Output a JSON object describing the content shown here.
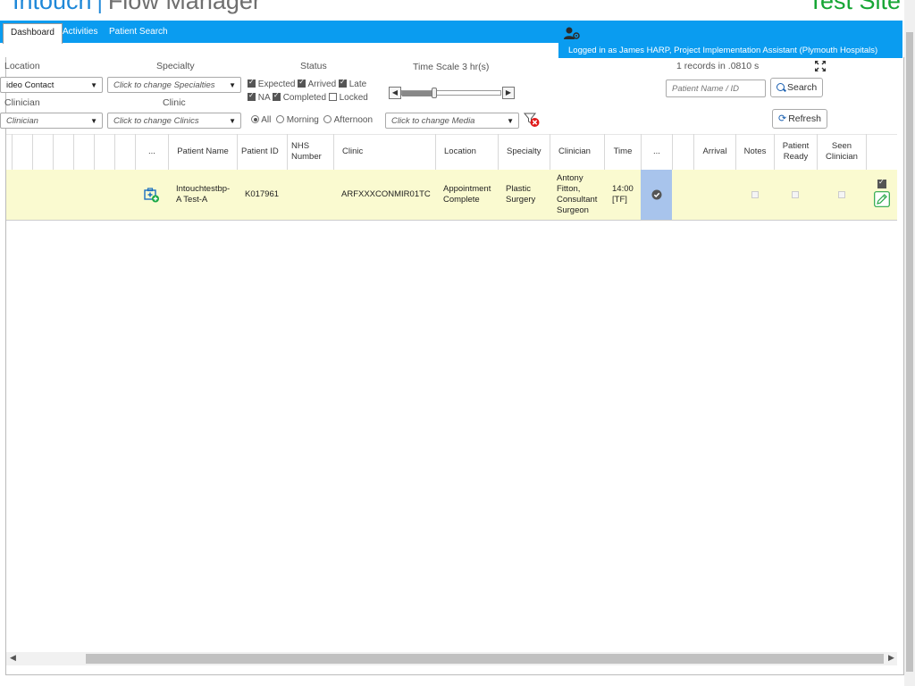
{
  "header": {
    "brand": "Intouch",
    "separator": "|",
    "product": "Flow Manager",
    "site": "Test Site"
  },
  "nav": {
    "tabs": [
      {
        "label": "Dashboard",
        "active": true
      },
      {
        "label": "Activities",
        "active": false
      },
      {
        "label": "Patient Search",
        "active": false
      }
    ],
    "user_icon": "user-gear-icon",
    "login_text": "Logged in as James HARP, Project Implementation Assistant (Plymouth Hospitals)"
  },
  "filters": {
    "location_label": "Location",
    "location_value": "ideo Contact",
    "specialty_label": "Specialty",
    "specialty_placeholder": "Click to change Specialties",
    "clinician_label": "Clinician",
    "clinician_value": "Clinician",
    "clinic_label": "Clinic",
    "clinic_placeholder": "Click to change Clinics",
    "status_label": "Status",
    "statuses": [
      {
        "label": "Expected",
        "checked": true
      },
      {
        "label": "Arrived",
        "checked": true
      },
      {
        "label": "Late",
        "checked": true
      },
      {
        "label": "NA",
        "checked": true
      },
      {
        "label": "Completed",
        "checked": true
      },
      {
        "label": "Locked",
        "checked": false
      }
    ],
    "time_options": [
      {
        "label": "All",
        "selected": true
      },
      {
        "label": "Morning",
        "selected": false
      },
      {
        "label": "Afternoon",
        "selected": false
      }
    ],
    "media_placeholder": "Click to change Media",
    "timescale_label": "Time Scale",
    "timescale_value": "3",
    "timescale_unit": "hr(s)",
    "timescale_fraction": 0.33,
    "clear_filter_icon": "filter-clear-icon"
  },
  "records": {
    "count_text": "1 records in .0810 s"
  },
  "search": {
    "placeholder": "Patient Name / ID",
    "button_label": "Search",
    "refresh_label": "Refresh"
  },
  "table": {
    "headers": {
      "more": "...",
      "patient_name": "Patient Name",
      "patient_id": "Patient ID",
      "nhs_number": "NHS Number",
      "clinic": "Clinic",
      "location": "Location",
      "specialty": "Specialty",
      "clinician": "Clinician",
      "time": "Time",
      "status_more": "...",
      "arrival": "Arrival",
      "notes": "Notes",
      "patient_ready": "Patient Ready",
      "seen_clinician": "Seen Clinician"
    },
    "rows": [
      {
        "icon": "add-medical-record-icon",
        "patient_name": "Intouchtestbp-A Test-A",
        "patient_id": "K017961",
        "nhs_number": "",
        "clinic": "ARFXXXCONMIR01TC",
        "location": "Appointment Complete",
        "specialty": "Plastic Surgery",
        "clinician": "Antony Fitton, Consultant Surgeon",
        "time": "14:00 [TF]",
        "status_icon": "check-circle-icon",
        "notes_checked": false,
        "ready_checked": false,
        "seen_checked": false,
        "row_checked": true,
        "edit_icon": "edit-pencil-icon"
      }
    ]
  },
  "colors": {
    "nav": "#0a9cf0",
    "brand": "#1e88d8",
    "site": "#16a534",
    "row": "#fafad0",
    "status_cell": "#a8c4ec"
  }
}
